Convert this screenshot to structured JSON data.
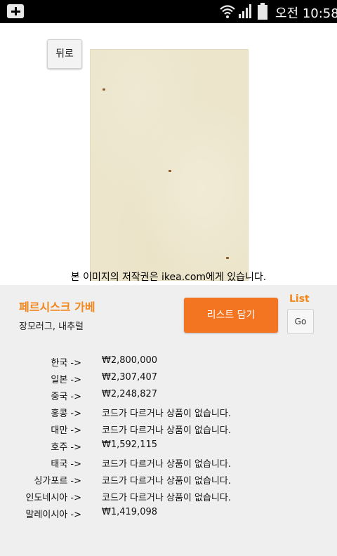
{
  "status_bar": {
    "time": "오전 10:58",
    "icons": [
      "add-notification-icon",
      "wifi-icon",
      "signal-icon",
      "battery-icon"
    ]
  },
  "image_panel": {
    "back_label": "뒤로",
    "copyright": "본 이미지의 저작권은 ikea.com에게 있습니다."
  },
  "product": {
    "name": "페르시스크 가베",
    "subtitle": "장모러그, 내추럴",
    "add_list_label": "리스트 담기",
    "list_label": "List",
    "go_label": "Go"
  },
  "prices": [
    {
      "country": "한국 ->",
      "value": "₩2,800,000"
    },
    {
      "country": "일본 ->",
      "value": "₩2,307,407"
    },
    {
      "country": "중국 ->",
      "value": "₩2,248,827"
    },
    {
      "country": "홍콩 ->",
      "value": "코드가 다르거나 상품이 없습니다."
    },
    {
      "country": "대만 ->",
      "value": "코드가 다르거나 상품이 없습니다."
    },
    {
      "country": "호주 ->",
      "value": "₩1,592,115"
    },
    {
      "country": "태국 ->",
      "value": "코드가 다르거나 상품이 없습니다."
    },
    {
      "country": "싱가포르 ->",
      "value": "코드가 다르거나 상품이 없습니다."
    },
    {
      "country": "인도네시아 ->",
      "value": "코드가 다르거나 상품이 없습니다."
    },
    {
      "country": "말레이시아 ->",
      "value": "₩1,419,098"
    }
  ],
  "colors": {
    "accent": "#f47521",
    "accent_text": "#f2871d",
    "status_bar_bg": "#000000",
    "section_bg": "#efefef"
  }
}
